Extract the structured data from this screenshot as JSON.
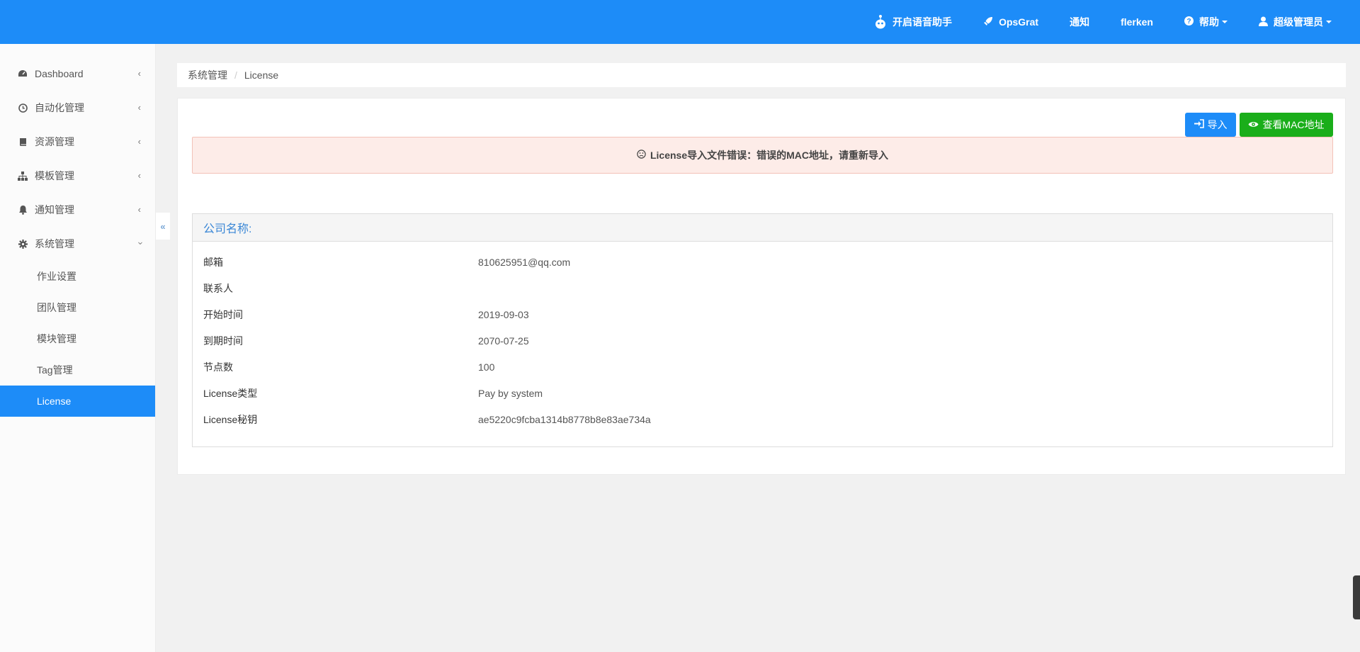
{
  "topnav": {
    "voice": "开启语音助手",
    "opsgrat": "OpsGrat",
    "notify": "通知",
    "user_flerken": "flerken",
    "help": "帮助",
    "admin": "超级管理员"
  },
  "sidebar": {
    "items": [
      {
        "label": "Dashboard",
        "icon": "dashboard-icon"
      },
      {
        "label": "自动化管理",
        "icon": "clock-icon"
      },
      {
        "label": "资源管理",
        "icon": "book-icon"
      },
      {
        "label": "模板管理",
        "icon": "sitemap-icon"
      },
      {
        "label": "通知管理",
        "icon": "bell-icon"
      },
      {
        "label": "系统管理",
        "icon": "gear-icon"
      }
    ],
    "subitems": [
      {
        "label": "作业设置"
      },
      {
        "label": "团队管理"
      },
      {
        "label": "模块管理"
      },
      {
        "label": "Tag管理"
      },
      {
        "label": "License",
        "active": true
      }
    ]
  },
  "breadcrumb": {
    "parent": "系统管理",
    "current": "License"
  },
  "buttons": {
    "import": "导入",
    "view_mac": "查看MAC地址"
  },
  "alert": {
    "message": "License导入文件错误：错误的MAC地址，请重新导入"
  },
  "license": {
    "company_label": "公司名称:",
    "rows": [
      {
        "key": "邮箱",
        "value": "810625951@qq.com"
      },
      {
        "key": "联系人",
        "value": ""
      },
      {
        "key": "开始时间",
        "value": "2019-09-03"
      },
      {
        "key": "到期时间",
        "value": "2070-07-25"
      },
      {
        "key": "节点数",
        "value": "100"
      },
      {
        "key": "License类型",
        "value": "Pay by system"
      },
      {
        "key": "License秘钥",
        "value": "ae5220c9fcba1314b8778b8e83ae734a"
      }
    ]
  },
  "colors": {
    "primary": "#1d8cf8",
    "success": "#1aae1a",
    "alert_bg": "#fdece8"
  }
}
